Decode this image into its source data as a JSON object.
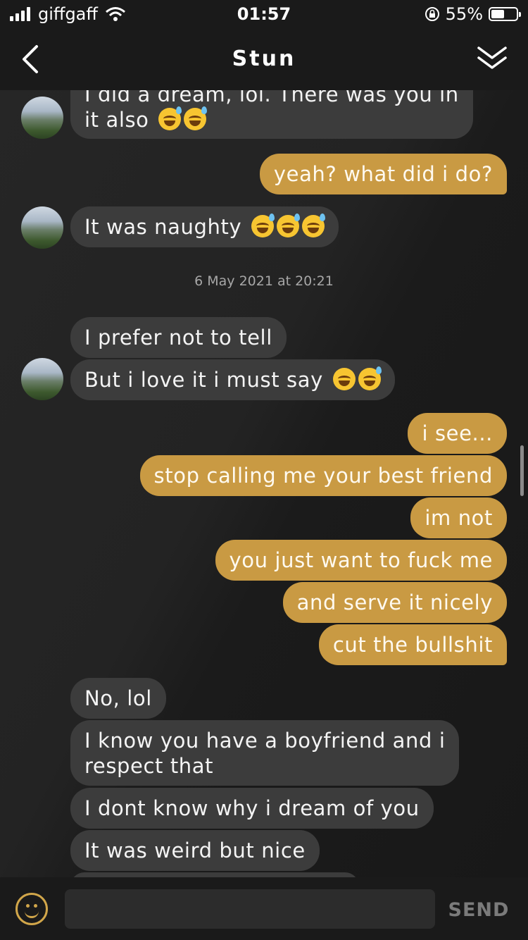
{
  "status_bar": {
    "carrier": "giffgaff",
    "time": "01:57",
    "battery": "55%"
  },
  "header": {
    "title": "Stun"
  },
  "messages": [
    {
      "dir": "in",
      "text_line1": "I did a dream, lol. There was you in",
      "text_line2": "it also"
    },
    {
      "dir": "out",
      "text": "yeah? what did i do?"
    },
    {
      "dir": "in",
      "text": "It was naughty"
    },
    {
      "dir": "timestamp",
      "text": "6 May 2021 at 20:21"
    },
    {
      "dir": "in",
      "text": "I prefer not to tell"
    },
    {
      "dir": "in",
      "text": "But i love it i must say"
    },
    {
      "dir": "out",
      "text": "i see..."
    },
    {
      "dir": "out",
      "text": "stop calling me your best friend"
    },
    {
      "dir": "out",
      "text": "im not"
    },
    {
      "dir": "out",
      "text": "you just want to fuck me"
    },
    {
      "dir": "out",
      "text": "and serve it nicely"
    },
    {
      "dir": "out",
      "text": "cut the bullshit"
    },
    {
      "dir": "in",
      "text": "No, lol"
    },
    {
      "dir": "in",
      "text_line1": "I know you have a boyfriend and i",
      "text_line2": "respect that"
    },
    {
      "dir": "in",
      "text": "I dont know why i dream of you"
    },
    {
      "dir": "in",
      "text": "It was weird but nice"
    }
  ],
  "composer": {
    "placeholder": "",
    "send_label": "SEND"
  },
  "colors": {
    "outgoing_bubble": "#c99a43",
    "incoming_bubble": "#3c3c3c",
    "accent": "#d1a64a"
  }
}
